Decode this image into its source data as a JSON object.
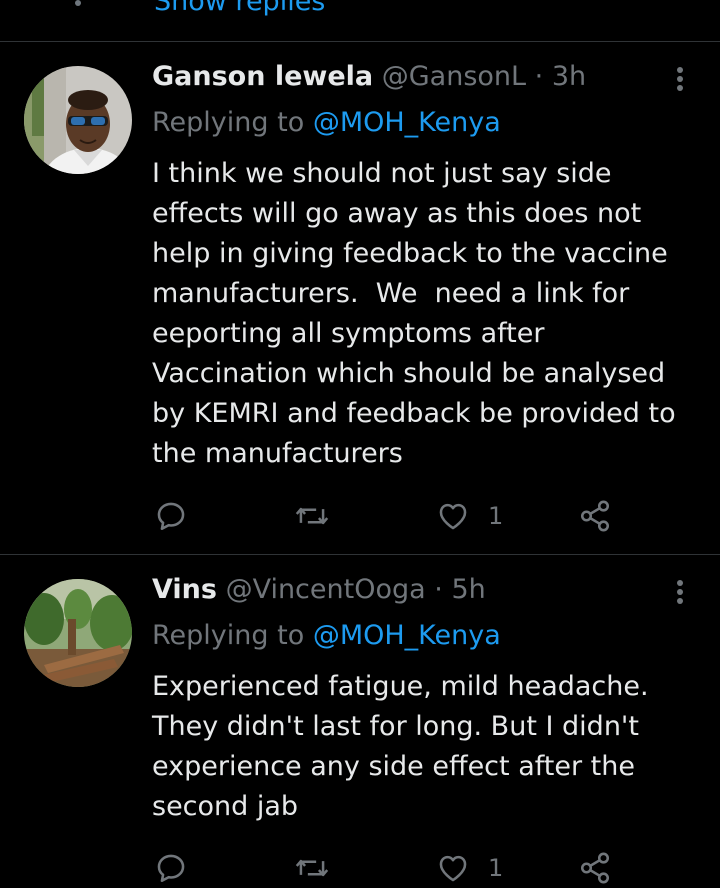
{
  "top": {
    "show_replies_label": "Show replies"
  },
  "tweets": [
    {
      "name": "Ganson lewela",
      "handle": "@GansonL",
      "separator": "·",
      "time": "3h",
      "replying_prefix": "Replying to",
      "replying_handle": "@MOH_Kenya",
      "text": "I think we should not just say side\neffects will go away as this does not\nhelp in giving feedback to the vaccine\nmanufacturers.  We  need a link for\neeporting all symptoms after\nVaccination which should be analysed\nby KEMRI and feedback be provided to\nthe manufacturers",
      "reply_count": "",
      "retweet_count": "",
      "like_count": "1"
    },
    {
      "name": "Vins",
      "handle": "@VincentOoga",
      "separator": "·",
      "time": "5h",
      "replying_prefix": "Replying to",
      "replying_handle": "@MOH_Kenya",
      "text": "Experienced fatigue, mild headache.\nThey didn't last for long. But I didn't\nexperience any side effect after the\nsecond jab",
      "reply_count": "",
      "retweet_count": "",
      "like_count": "1"
    }
  ],
  "icons": {
    "reply": "reply-icon",
    "retweet": "retweet-icon",
    "like": "heart-icon",
    "share": "share-icon",
    "more": "more-icon"
  },
  "colors": {
    "background": "#000000",
    "text": "#e7e9ea",
    "secondary": "#71767b",
    "accent": "#1d9bf0",
    "divider": "#2f3336"
  }
}
